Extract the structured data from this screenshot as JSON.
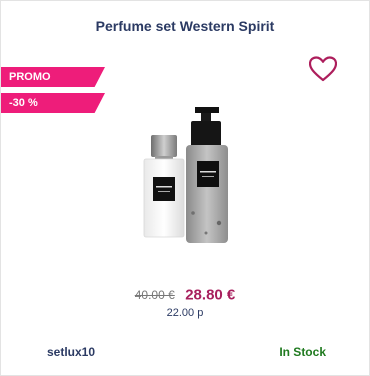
{
  "product": {
    "title": "Perfume set Western Spirit",
    "image_icon": "perfume-set-image"
  },
  "badges": {
    "promo": "PROMO",
    "discount": "-30 %",
    "color": "#ee1d7a"
  },
  "wishlist": {
    "icon": "heart-outline-icon",
    "color": "#ad1e5c"
  },
  "pricing": {
    "old_price": "40.00 €",
    "new_price": "28.80 €",
    "points": "22.00 p"
  },
  "footer": {
    "sku": "setlux10",
    "stock_status": "In Stock",
    "stock_color": "#1f7a1f"
  }
}
